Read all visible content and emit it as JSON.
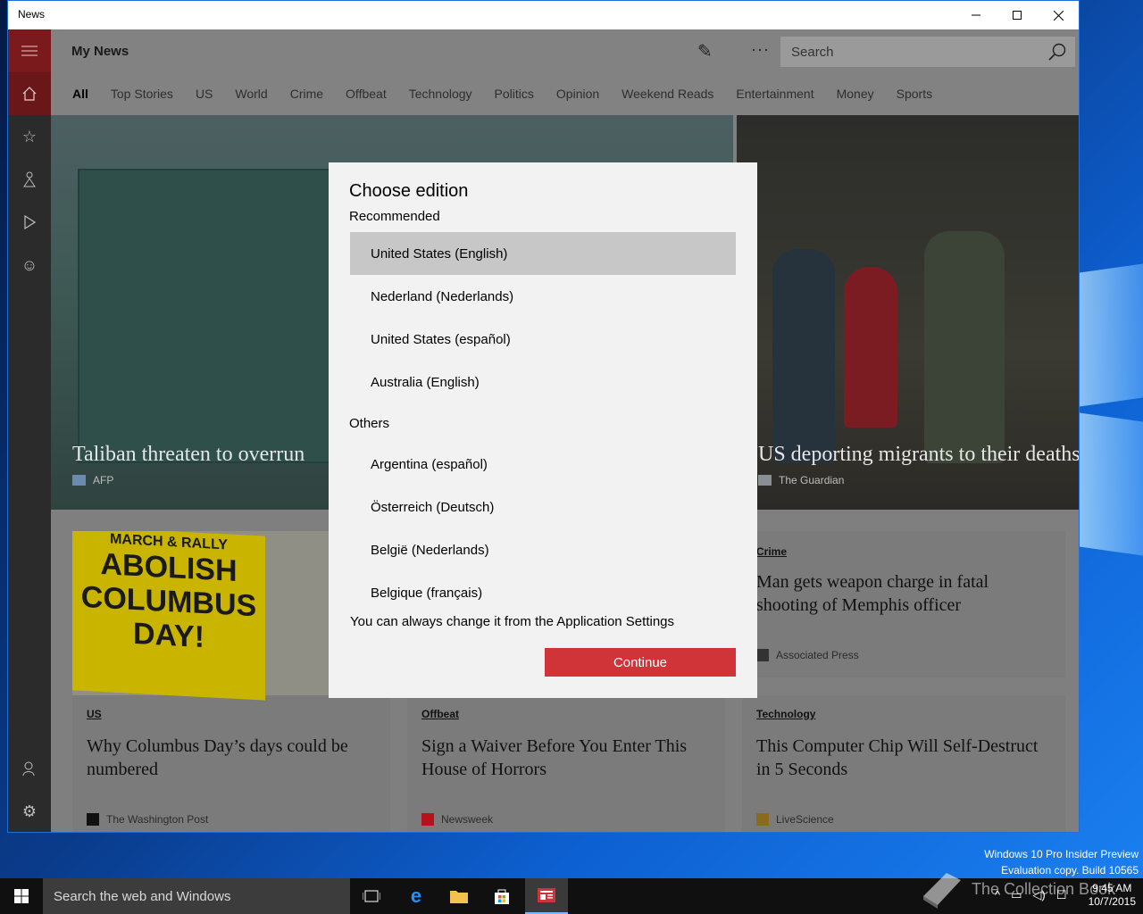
{
  "window": {
    "title": "News"
  },
  "header": {
    "app_title": "My News",
    "search_placeholder": "Search",
    "more_label": "···"
  },
  "tabs": [
    {
      "label": "All",
      "active": true
    },
    {
      "label": "Top Stories"
    },
    {
      "label": "US"
    },
    {
      "label": "World"
    },
    {
      "label": "Crime"
    },
    {
      "label": "Offbeat"
    },
    {
      "label": "Technology"
    },
    {
      "label": "Politics"
    },
    {
      "label": "Opinion"
    },
    {
      "label": "Weekend Reads"
    },
    {
      "label": "Entertainment"
    },
    {
      "label": "Money"
    },
    {
      "label": "Sports"
    }
  ],
  "hero": [
    {
      "headline": "Taliban threaten to overrun",
      "source": "AFP"
    },
    {
      "headline": "US deporting migrants to their deaths",
      "source": "The Guardian"
    }
  ],
  "cards": [
    {
      "category": "Crime",
      "headline": "Man gets weapon charge in fatal shooting of Memphis officer",
      "source": "Associated Press"
    },
    {
      "category": "US",
      "headline": "Why Columbus Day’s days could be numbered",
      "source": "The Washington Post",
      "image_text": [
        "MARCH & RALLY",
        "ABOLISH",
        "COLUMBUS",
        "DAY!"
      ]
    },
    {
      "category": "Offbeat",
      "headline": "Sign a Waiver Before You Enter This House of Horrors",
      "source": "Newsweek"
    },
    {
      "category": "Technology",
      "headline": "This Computer Chip Will Self-Destruct in 5 Seconds",
      "source": "LiveScience"
    }
  ],
  "dialog": {
    "title": "Choose edition",
    "recommended_label": "Recommended",
    "recommended": [
      "United States (English)",
      "Nederland (Nederlands)",
      "United States (español)",
      "Australia (English)"
    ],
    "selected": "United States (English)",
    "others_label": "Others",
    "others": [
      "Argentina (español)",
      "Österreich (Deutsch)",
      "België (Nederlands)",
      "Belgique (français)"
    ],
    "note": "You can always change it from the Application Settings",
    "continue_label": "Continue"
  },
  "desktop": {
    "watermark_line1": "Windows 10 Pro Insider Preview",
    "watermark_line2": "Evaluation copy. Build 10565",
    "overlay_brand": "The Collection Book"
  },
  "taskbar": {
    "search_placeholder": "Search the web and Windows",
    "time": "9:45 AM",
    "date": "10/7/2015"
  },
  "colors": {
    "accent": "#d13438",
    "sidebar_active": "#7a1a1d",
    "dialog_bg": "#f2f2f2",
    "selection": "#c7c7c7"
  }
}
